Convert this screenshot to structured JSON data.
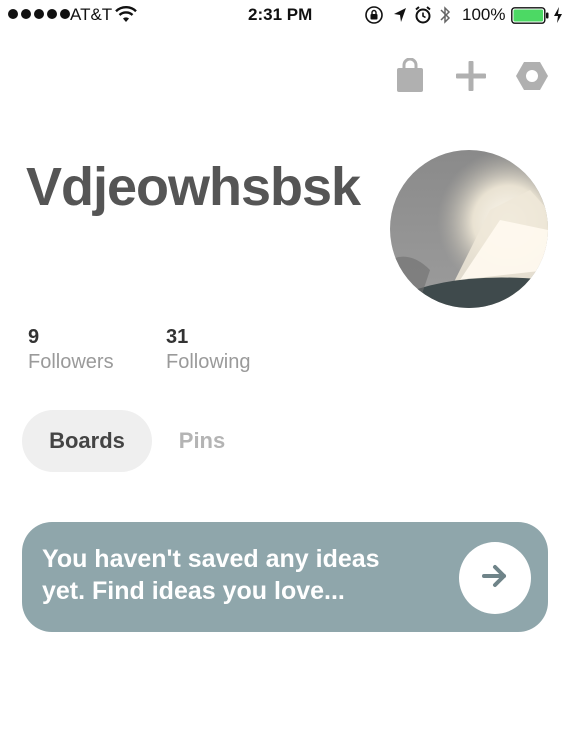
{
  "status_bar": {
    "carrier": "AT&T",
    "time": "2:31 PM",
    "battery_percent": "100%",
    "signal_bars": 5,
    "battery_level": 1.0
  },
  "toolbar": {
    "icons": [
      "shopping-bag-icon",
      "plus-icon",
      "settings-icon"
    ]
  },
  "profile": {
    "name": "Vdjeowhsbsk",
    "followers_count": "9",
    "followers_label": "Followers",
    "following_count": "31",
    "following_label": "Following"
  },
  "tabs": {
    "boards": "Boards",
    "pins": "Pins"
  },
  "banner": {
    "text": "You haven't saved any ideas\nyet. Find ideas you love...",
    "icon": "arrow-right-icon",
    "color": "#8fa6ab"
  },
  "colors": {
    "name_text": "#555555",
    "icon_gray": "#b0b0b0",
    "inactive_text": "#b4b4b4"
  }
}
